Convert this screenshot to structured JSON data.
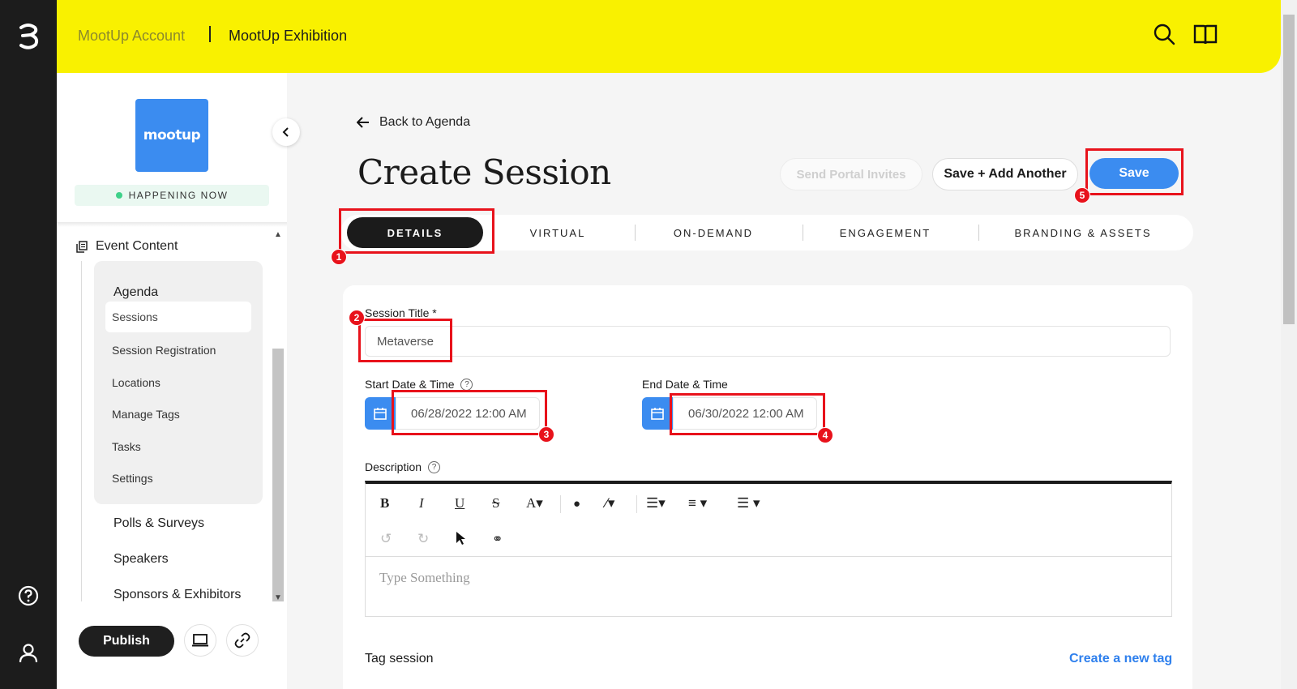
{
  "header": {
    "account": "MootUp Account",
    "event": "MootUp Exhibition"
  },
  "sidebar": {
    "logo_text": "mootup",
    "status": "HAPPENING NOW",
    "section_title": "Event Content",
    "agenda_label": "Agenda",
    "agenda_items": [
      "Sessions",
      "Session Registration",
      "Locations",
      "Manage Tags",
      "Tasks",
      "Settings"
    ],
    "main_items": [
      "Polls & Surveys",
      "Speakers",
      "Sponsors & Exhibitors"
    ],
    "publish": "Publish"
  },
  "main": {
    "back": "Back to Agenda",
    "title": "Create Session",
    "buttons": {
      "send_invites": "Send Portal Invites",
      "save_add": "Save + Add Another",
      "save": "Save"
    },
    "tabs": [
      "DETAILS",
      "VIRTUAL",
      "ON-DEMAND",
      "ENGAGEMENT",
      "BRANDING & ASSETS"
    ],
    "form": {
      "session_title_label": "Session Title *",
      "session_title_value": "Metaverse",
      "start_label": "Start Date & Time",
      "start_value": "06/28/2022 12:00 AM",
      "end_label": "End Date & Time",
      "end_value": "06/30/2022 12:00 AM",
      "description_label": "Description",
      "description_placeholder": "Type Something",
      "tag_label": "Tag session",
      "create_tag": "Create a new tag"
    },
    "annotations": [
      "1",
      "2",
      "3",
      "4",
      "5"
    ]
  },
  "colors": {
    "brand_yellow": "#f9f100",
    "accent_blue": "#3b8cf0",
    "highlight_red": "#e8121b"
  }
}
